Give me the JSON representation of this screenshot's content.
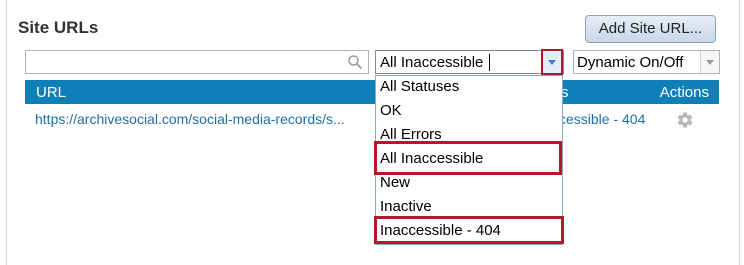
{
  "panel": {
    "title": "Site URLs",
    "add_button_label": "Add Site URL..."
  },
  "search": {
    "placeholder": "",
    "value": "",
    "icon": "search-icon"
  },
  "status_filter": {
    "selected": "All Inaccessible",
    "options": [
      "All Statuses",
      "OK",
      "All Errors",
      "All Inaccessible",
      "New",
      "Inactive",
      "Inaccessible - 404"
    ],
    "highlighted_options": [
      "All Inaccessible",
      "Inaccessible - 404"
    ],
    "highlight_color": "#b5162b"
  },
  "dynamic_filter": {
    "selected": "Dynamic On/Off"
  },
  "table": {
    "header_color": "#0e7fb7",
    "columns": {
      "url": "URL",
      "status": "s",
      "actions": "Actions"
    },
    "rows": [
      {
        "url": "https://archivesocial.com/social-media-records/s...",
        "status": "ccessible - 404",
        "action_icon": "gear-icon"
      }
    ]
  }
}
